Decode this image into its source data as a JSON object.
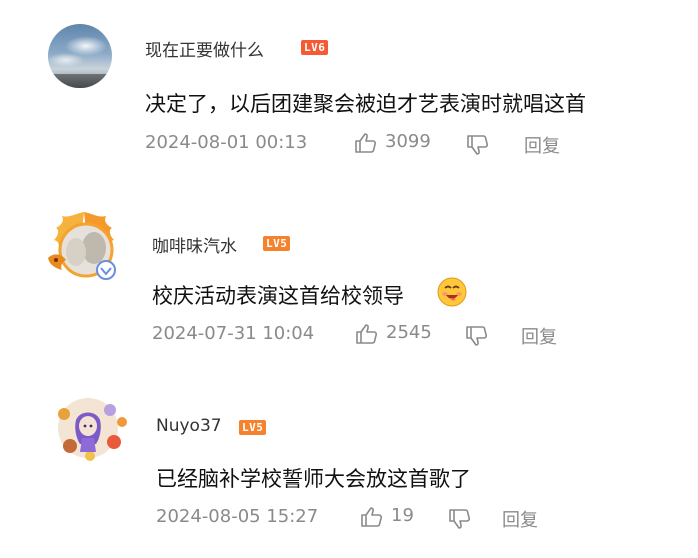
{
  "comments": [
    {
      "username": "现在正要做什么",
      "level": "LV6",
      "content": "决定了，以后团建聚会被迫才艺表演时就唱这首",
      "date": "2024-08-01 00:13",
      "likes": "3099",
      "reply_label": "回复"
    },
    {
      "username": "咖啡味汽水",
      "level": "LV5",
      "content": "校庆活动表演这首给校领导",
      "emoji": "yummy-face-emoji",
      "date": "2024-07-31 10:04",
      "likes": "2545",
      "reply_label": "回复"
    },
    {
      "username": "Nuyo37",
      "level": "LV5",
      "content": "已经脑补学校誓师大会放这首歌了",
      "date": "2024-08-05 15:27",
      "likes": "19",
      "reply_label": "回复"
    }
  ],
  "colors": {
    "text_primary": "#111111",
    "text_secondary": "#8a8a8a",
    "level_lv6": "#f55a34",
    "level_lv5": "#f5822c"
  },
  "icons": [
    "thumbs-up-icon",
    "thumbs-down-icon"
  ]
}
